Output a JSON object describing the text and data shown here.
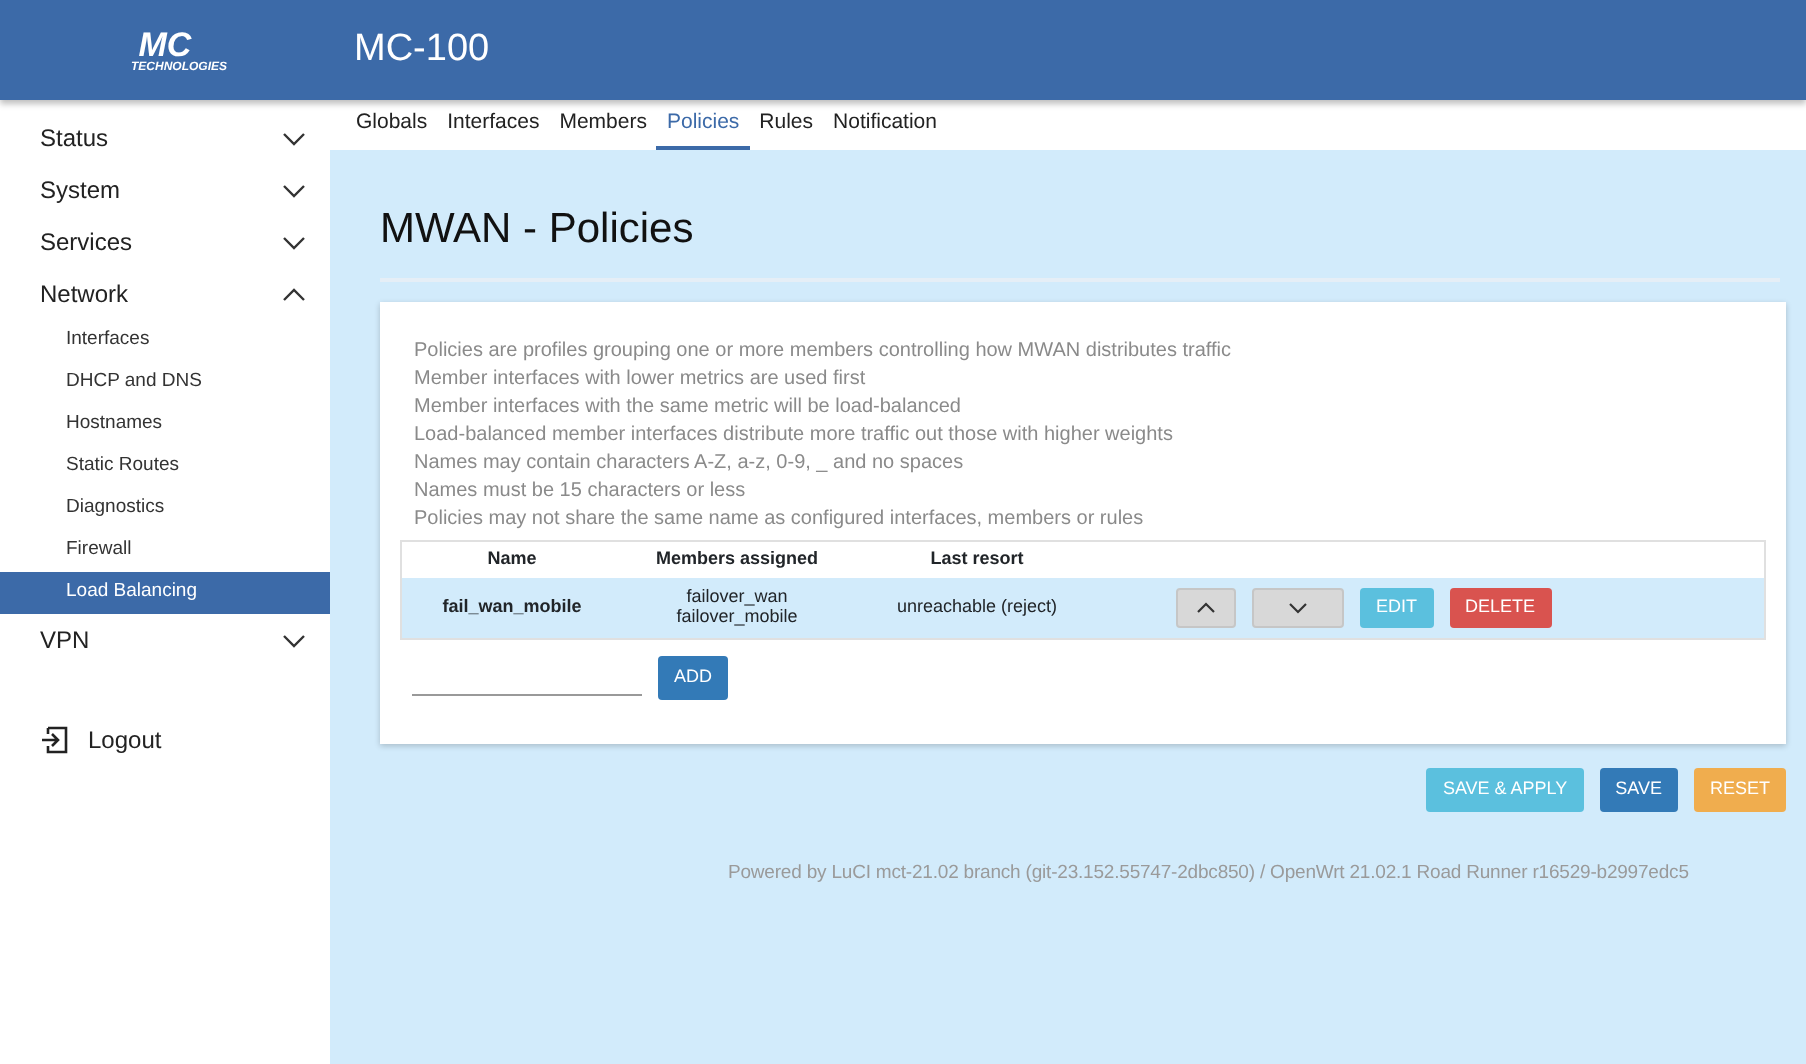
{
  "header": {
    "logo_main": "MC",
    "logo_sub": "TECHNOLOGIES",
    "title": "MC-100"
  },
  "sidebar": {
    "items": [
      {
        "label": "Status",
        "expanded": false
      },
      {
        "label": "System",
        "expanded": false
      },
      {
        "label": "Services",
        "expanded": false
      },
      {
        "label": "Network",
        "expanded": true,
        "children": [
          {
            "label": "Interfaces",
            "selected": false
          },
          {
            "label": "DHCP and DNS",
            "selected": false
          },
          {
            "label": "Hostnames",
            "selected": false
          },
          {
            "label": "Static Routes",
            "selected": false
          },
          {
            "label": "Diagnostics",
            "selected": false
          },
          {
            "label": "Firewall",
            "selected": false
          },
          {
            "label": "Load Balancing",
            "selected": true
          }
        ]
      },
      {
        "label": "VPN",
        "expanded": false
      }
    ],
    "logout": "Logout"
  },
  "tabs": [
    {
      "label": "Globals",
      "selected": false
    },
    {
      "label": "Interfaces",
      "selected": false
    },
    {
      "label": "Members",
      "selected": false
    },
    {
      "label": "Policies",
      "selected": true
    },
    {
      "label": "Rules",
      "selected": false
    },
    {
      "label": "Notification",
      "selected": false
    }
  ],
  "page_title": "MWAN - Policies",
  "description": [
    "Policies are profiles grouping one or more members controlling how MWAN distributes traffic",
    "Member interfaces with lower metrics are used first",
    "Member interfaces with the same metric will be load-balanced",
    "Load-balanced member interfaces distribute more traffic out those with higher weights",
    "Names may contain characters A-Z, a-z, 0-9, _ and no spaces",
    "Names must be 15 characters or less",
    "Policies may not share the same name as configured interfaces, members or rules"
  ],
  "table": {
    "columns": [
      "Name",
      "Members assigned",
      "Last resort"
    ],
    "rows": [
      {
        "name": "fail_wan_mobile",
        "members": [
          "failover_wan",
          "failover_mobile"
        ],
        "last_resort": "unreachable (reject)",
        "edit": "EDIT",
        "delete": "DELETE"
      }
    ]
  },
  "add_button": "ADD",
  "actions": [
    {
      "label": "SAVE & APPLY",
      "kind": "info"
    },
    {
      "label": "SAVE",
      "kind": "primary"
    },
    {
      "label": "RESET",
      "kind": "warning"
    }
  ],
  "footer": "Powered by LuCI mct-21.02 branch (git-23.152.55747-2dbc850) / OpenWrt 21.02.1 Road Runner r16529-b2997edc5"
}
